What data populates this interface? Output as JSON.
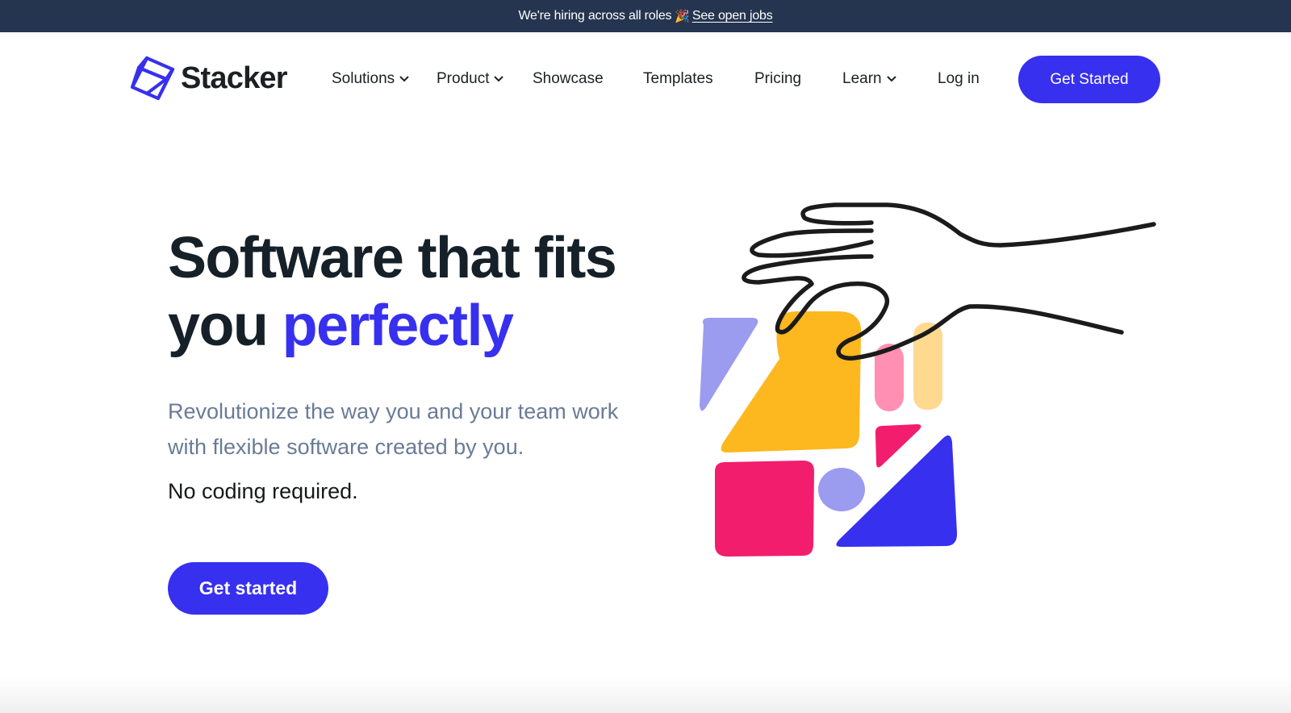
{
  "announcement": {
    "text": "We're hiring across all roles",
    "emoji": "🎉",
    "link_text": "See open jobs"
  },
  "brand": {
    "name": "Stacker",
    "logo_icon": "stacker-logo-icon",
    "accent_color": "#3730ef"
  },
  "nav": {
    "items": [
      {
        "label": "Solutions",
        "has_dropdown": true
      },
      {
        "label": "Product",
        "has_dropdown": true
      },
      {
        "label": "Showcase",
        "has_dropdown": false
      },
      {
        "label": "Templates",
        "has_dropdown": false
      },
      {
        "label": "Pricing",
        "has_dropdown": false
      },
      {
        "label": "Learn",
        "has_dropdown": true
      },
      {
        "label": "Log in",
        "has_dropdown": false
      }
    ],
    "cta_label": "Get Started"
  },
  "hero": {
    "title_line1": "Software that fits",
    "title_line2_plain": "you ",
    "title_line2_accent": "perfectly",
    "subtitle": "Revolutionize the way you and your team work with flexible software created by you.",
    "note": "No coding required.",
    "cta_label": "Get started",
    "illustration": "hand-placing-colorful-blocks-illustration"
  }
}
